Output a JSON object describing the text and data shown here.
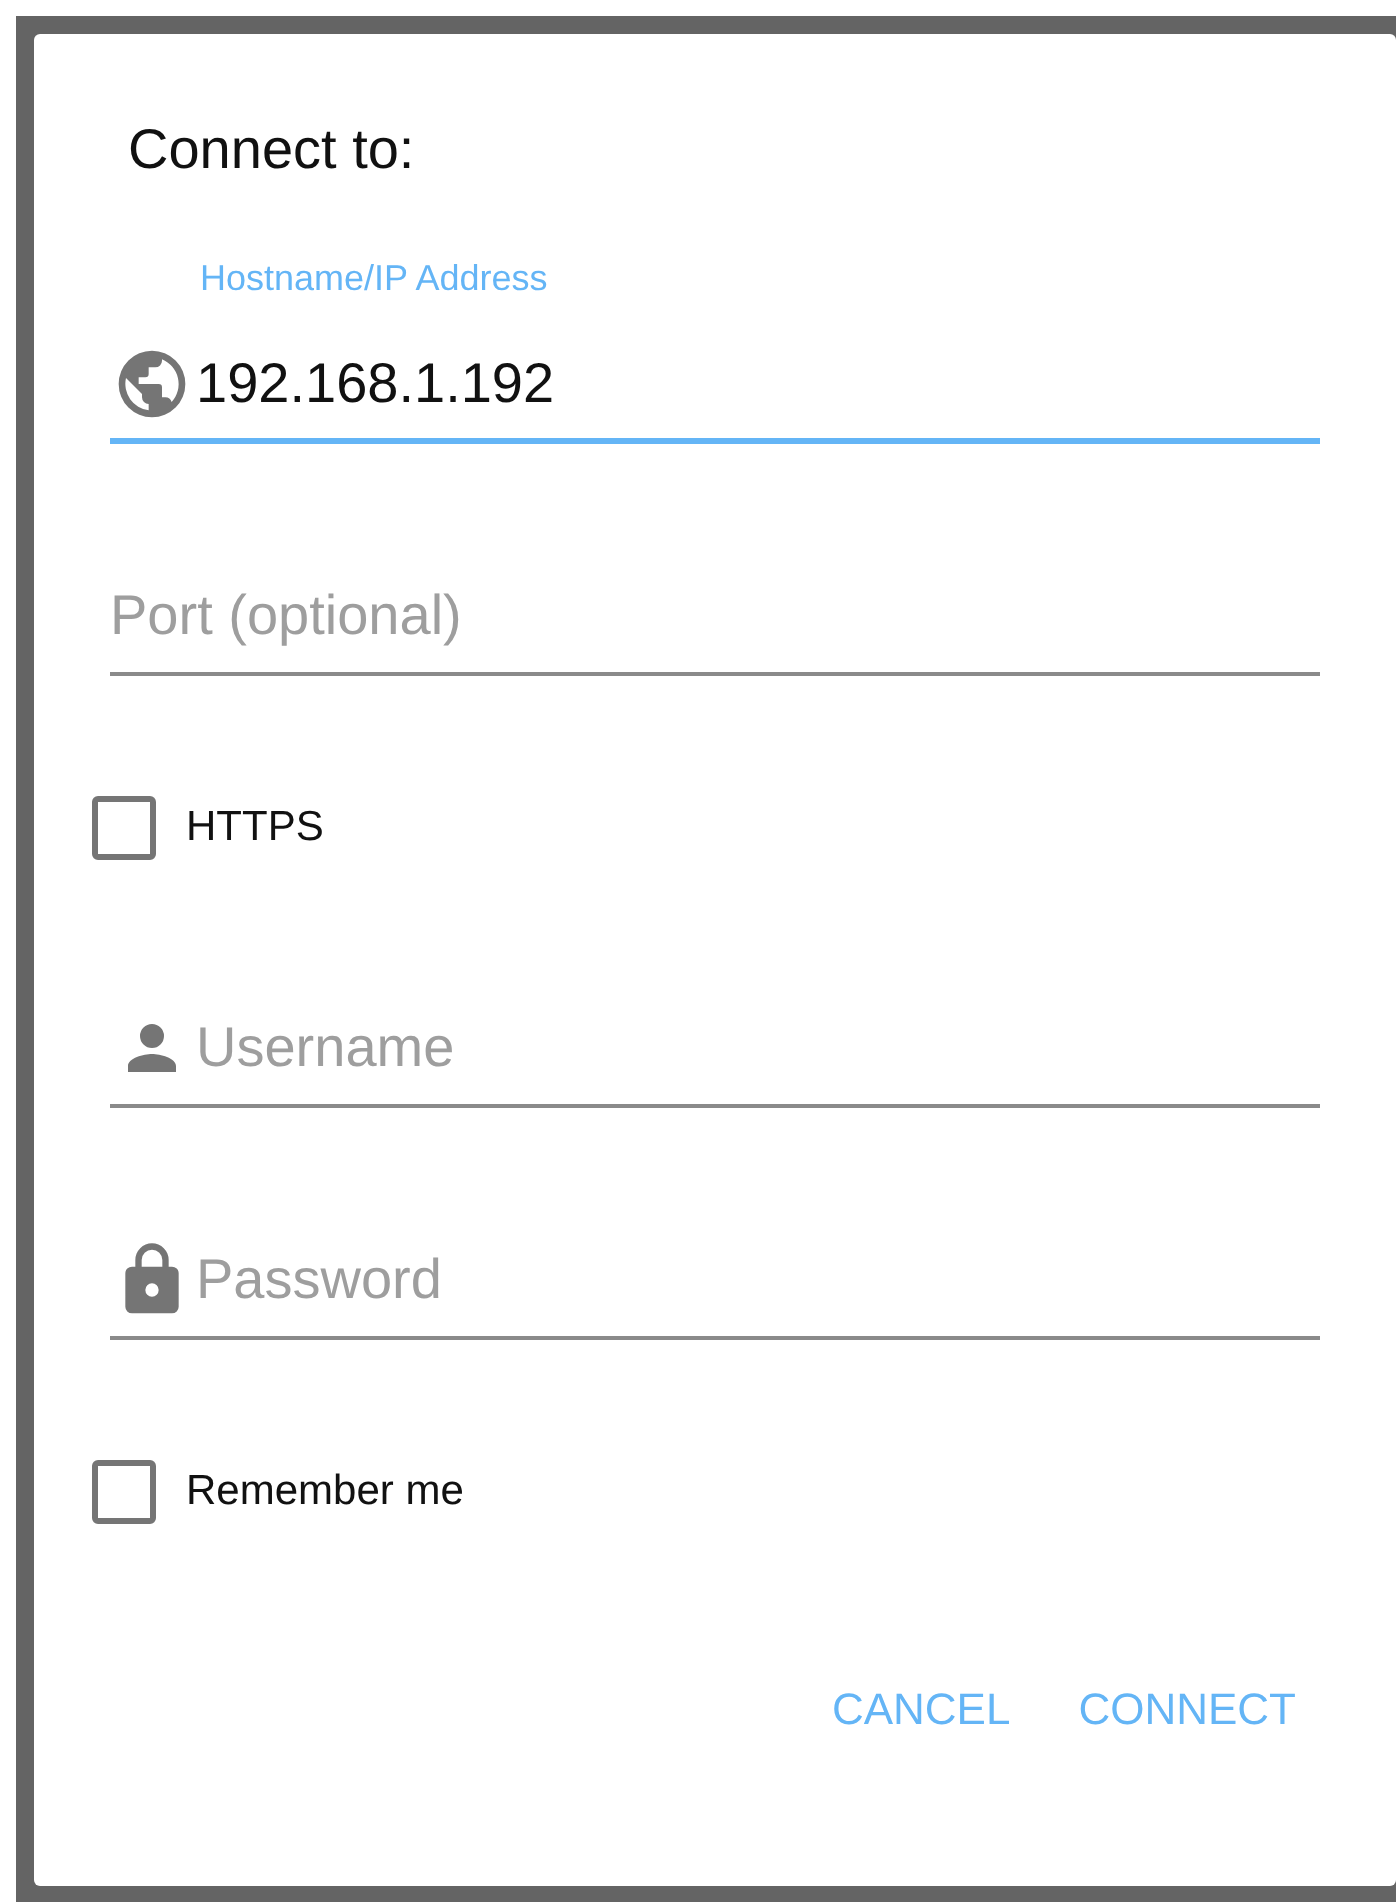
{
  "dialog": {
    "title": "Connect to:",
    "items": [
      {
        "kind": "host",
        "label": "Hostname/IP Address",
        "value": "192.168.1.192",
        "focused": true
      },
      {
        "kind": "port",
        "placeholder": "Port (optional)",
        "focused": false
      },
      {
        "kind": "checkbox",
        "label": "HTTPS",
        "checked": false
      },
      {
        "kind": "username",
        "placeholder": "Username",
        "focused": false
      },
      {
        "kind": "password",
        "placeholder": "Password",
        "focused": false
      },
      {
        "kind": "checkbox",
        "label": "Remember me",
        "checked": false
      }
    ],
    "buttons": [
      "CANCEL",
      "CONNECT"
    ]
  }
}
